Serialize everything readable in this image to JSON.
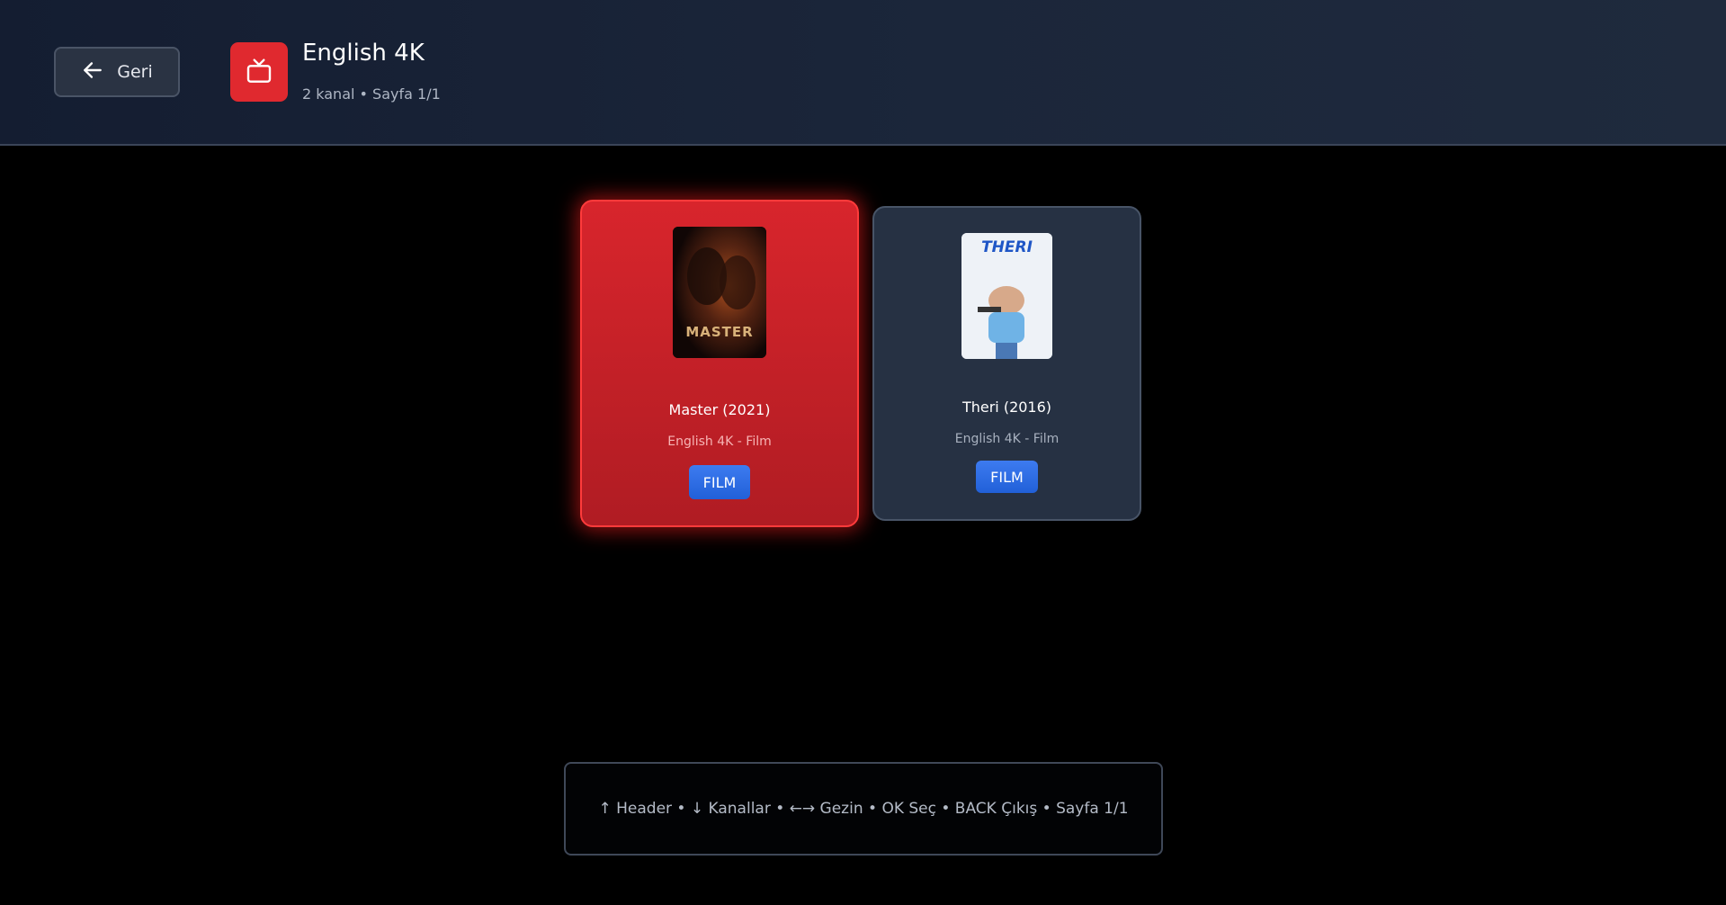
{
  "header": {
    "back_label": "Geri",
    "back_icon": "arrow-left-icon",
    "category_icon": "tv-icon",
    "category_icon_color": "#e0292f",
    "title": "English 4K",
    "subtitle": "2 kanal • Sayfa 1/1"
  },
  "channels": [
    {
      "title": "Master (2021)",
      "subtitle": "English 4K - Film",
      "badge": "FILM",
      "poster_text": "MASTER",
      "selected": true
    },
    {
      "title": "Theri (2016)",
      "subtitle": "English 4K - Film",
      "badge": "FILM",
      "poster_text": "THERI",
      "selected": false
    }
  ],
  "footer": {
    "hint": "↑ Header • ↓ Kanallar • ←→ Gezin • OK Seç • BACK Çıkış • Sayfa 1/1"
  },
  "colors": {
    "selected_card": "#d8252c",
    "card": "#263143",
    "badge": "#2f6fe8",
    "header_bg": "#1b263a"
  }
}
